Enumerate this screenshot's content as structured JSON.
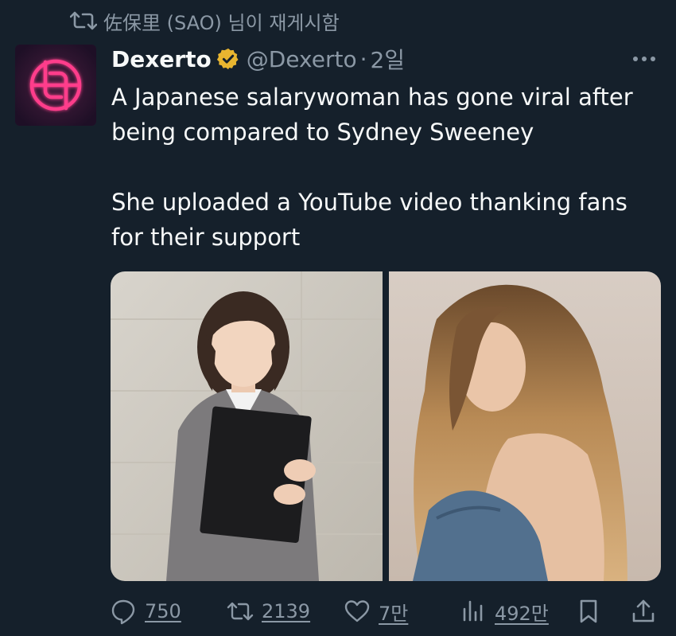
{
  "repost": {
    "icon": "retweet-icon",
    "text": "佐保里 (SAO) 님이 재게시함"
  },
  "author": {
    "name": "Dexerto",
    "verified_icon": "verified-badge-icon",
    "handle": "@Dexerto",
    "separator": "·",
    "time": "2일",
    "avatar_icon": "dexerto-logo-icon"
  },
  "tweet": {
    "paragraphs": [
      "A Japanese salarywoman has gone viral after being compared to Sydney Sweeney",
      "She uploaded a YouTube video thanking fans for their support"
    ]
  },
  "media": {
    "photo_left_icon": "photo-japanese-woman",
    "photo_right_icon": "photo-sydney-sweeney"
  },
  "actions": {
    "reply": {
      "icon": "reply-bubble-icon",
      "count": "750"
    },
    "repost": {
      "icon": "retweet-icon",
      "count": "2139"
    },
    "like": {
      "icon": "heart-icon",
      "count": "7만"
    },
    "views": {
      "icon": "views-bar-chart-icon",
      "count": "492만"
    },
    "bookmark": {
      "icon": "bookmark-icon"
    },
    "share": {
      "icon": "share-icon"
    }
  },
  "colors": {
    "background": "#15202b",
    "text_primary": "#f7f9f9",
    "text_secondary": "#8b98a5",
    "verified_gold": "#e8b530",
    "avatar_neon": "#ff3d8b"
  }
}
